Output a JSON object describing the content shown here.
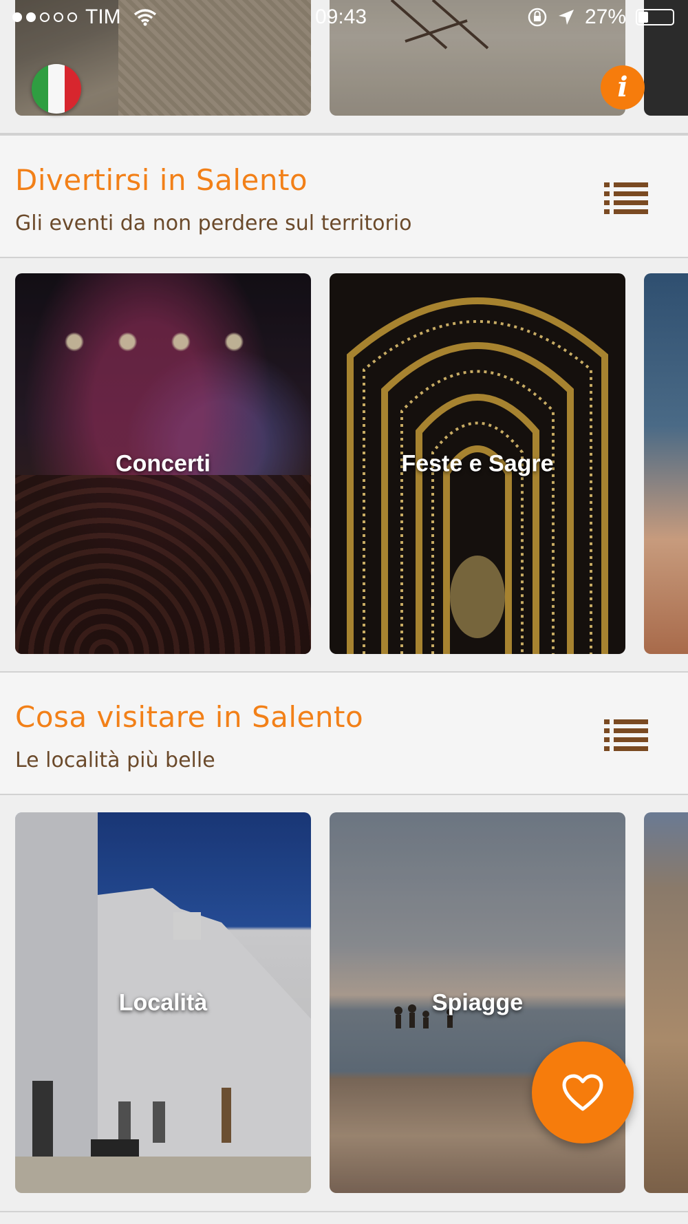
{
  "status_bar": {
    "carrier": "TIM",
    "time": "09:43",
    "battery": "27%",
    "signal_bars_filled": 2,
    "signal_bars_total": 5
  },
  "sections": [
    {
      "title": "Divertirsi in Salento",
      "subtitle": "Gli eventi da non perdere sul territorio",
      "cards": [
        {
          "label": "Concerti"
        },
        {
          "label": "Feste e Sagre"
        }
      ]
    },
    {
      "title": "Cosa visitare in Salento",
      "subtitle": "Le località più belle",
      "cards": [
        {
          "label": "Località"
        },
        {
          "label": "Spiagge"
        }
      ]
    }
  ],
  "icons": {
    "list": "list-icon",
    "favorite": "heart-icon",
    "info": "info-icon",
    "language": "italy-flag-icon"
  },
  "colors": {
    "accent": "#f67c0c",
    "title": "#f28018",
    "subtitle": "#6b4a2b",
    "list_icon": "#7a4a22"
  }
}
